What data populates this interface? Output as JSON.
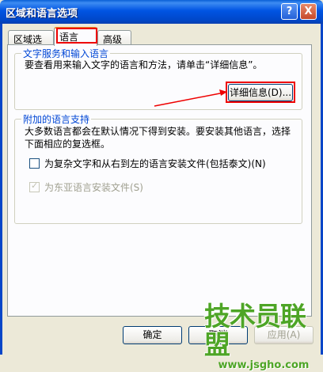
{
  "window": {
    "title": "区域和语言选项",
    "help_glyph": "?",
    "close_glyph": "X"
  },
  "tabs": [
    {
      "label": "区域选项",
      "selected": false
    },
    {
      "label": "语言",
      "selected": true
    },
    {
      "label": "高级",
      "selected": false
    }
  ],
  "text_services": {
    "legend": "文字服务和输入语言",
    "description": "要查看用来输入文字的语言和方法，请单击“详细信息”。",
    "details_button": "详细信息(D)..."
  },
  "supplemental": {
    "legend": "附加的语言支持",
    "description": "大多数语言都会在默认情况下得到安装。要安装其他语言，选择下面相应的复选框。",
    "options": [
      {
        "label": "为复杂文字和从右到左的语言安装文件(包括泰文)(N)",
        "checked": false,
        "enabled": true
      },
      {
        "label": "为东亚语言安装文件(S)",
        "checked": true,
        "enabled": false
      }
    ]
  },
  "footer": {
    "ok": "确定",
    "cancel": "取消",
    "apply": "应用(A)"
  },
  "watermark": {
    "main": "技术员联盟",
    "url": "www.jsgho.com"
  },
  "colors": {
    "titlebar": "#0054e3",
    "highlight": "#ee0000",
    "legend_text": "#0046d5",
    "watermark": "#4ea526"
  }
}
